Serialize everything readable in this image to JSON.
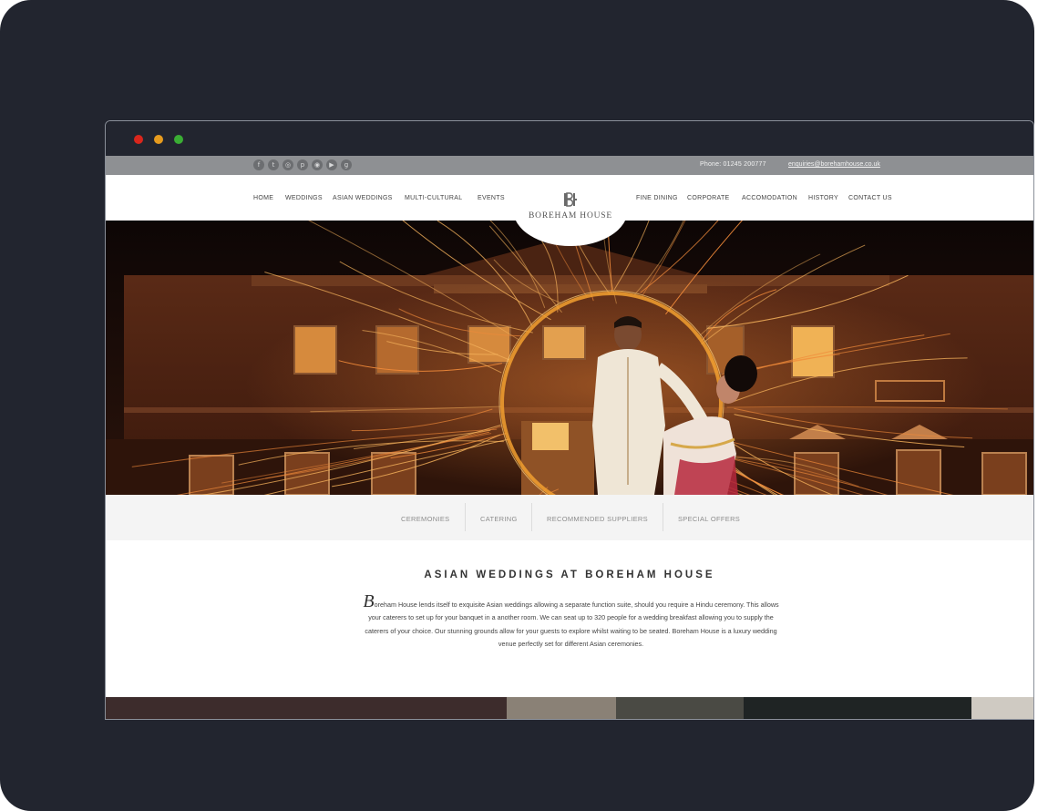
{
  "browser": {
    "dots": [
      "close",
      "minimize",
      "maximize"
    ]
  },
  "topbar": {
    "social_icons": [
      {
        "name": "facebook-icon",
        "glyph": "f"
      },
      {
        "name": "twitter-icon",
        "glyph": "t"
      },
      {
        "name": "instagram-icon",
        "glyph": "◎"
      },
      {
        "name": "pinterest-icon",
        "glyph": "p"
      },
      {
        "name": "tripadvisor-icon",
        "glyph": "◉"
      },
      {
        "name": "youtube-icon",
        "glyph": "▶"
      },
      {
        "name": "googleplus-icon",
        "glyph": "g"
      }
    ],
    "phone": "Phone: 01245 200777",
    "email": "enquiries@borehamhouse.co.uk"
  },
  "nav": {
    "items_left": [
      "HOME",
      "WEDDINGS",
      "ASIAN WEDDINGS",
      "MULTI-CULTURAL",
      "EVENTS"
    ],
    "items_right": [
      "FINE DINING",
      "CORPORATE",
      "ACCOMODATION",
      "HISTORY",
      "CONTACT US"
    ]
  },
  "logo": {
    "text": "BOREHAM HOUSE"
  },
  "subnav": {
    "items": [
      "CEREMONIES",
      "CATERING",
      "RECOMMENDED SUPPLIERS",
      "SPECIAL OFFERS"
    ]
  },
  "content": {
    "title": "ASIAN WEDDINGS AT BOREHAM HOUSE",
    "dropcap": "B",
    "body": "oreham House lends itself to exquisite Asian weddings allowing a separate function suite, should you require a Hindu ceremony. This allows your caterers to set up for your banquet in a another room. We can seat up to 320 people for a wedding breakfast allowing you to supply the caterers of your choice. Our stunning grounds allow for your guests to explore whilst waiting to be seated. Boreham House is a luxury wedding venue perfectly set for different Asian ceremonies."
  },
  "colors": {
    "frame_bg": "#22252f",
    "topbar_bg": "#8e9093",
    "subnav_bg": "#f4f4f4",
    "spark_orange": "#f08a3a"
  }
}
